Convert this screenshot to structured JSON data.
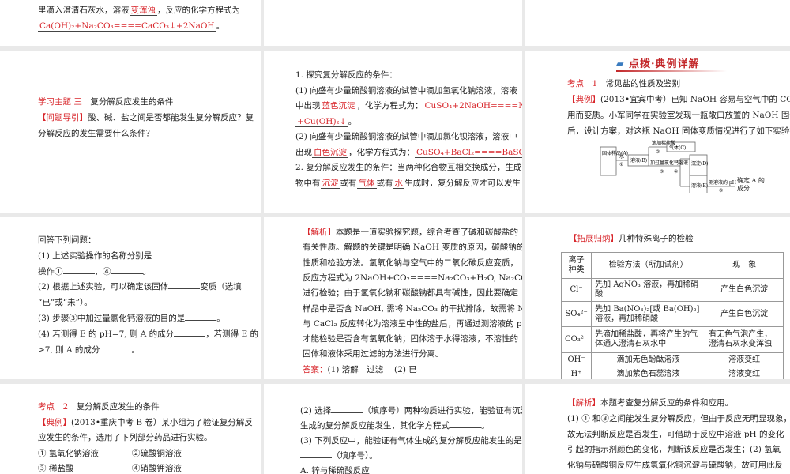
{
  "slides": [
    {
      "id": "s1",
      "lines": [
        [
          {
            "t": "里滴入澄清石灰水，溶液"
          },
          {
            "t": "变浑浊",
            "s": "redblank"
          },
          {
            "t": "，反应的化学方程式为"
          }
        ],
        [
          {
            "t": "Ca(OH)₂+Na₂CO₃====CaCO₃↓+2NaOH",
            "s": "redblank"
          },
          {
            "t": "。"
          }
        ]
      ]
    },
    {
      "id": "s2",
      "lines": [
        [
          {
            "t": "学习主题 三",
            "s": "red"
          },
          {
            "t": "　复分解反应发生的条件"
          }
        ],
        [
          {
            "t": "【问题导引】",
            "s": "red"
          },
          {
            "t": "酸、碱、盐之间是否都能发生复分解反应？复"
          }
        ],
        [
          {
            "t": "分解反应的发生需要什么条件？"
          }
        ]
      ]
    },
    {
      "id": "s3",
      "lines": [
        [
          {
            "t": "1. 探究复分解反应的条件："
          }
        ],
        [
          {
            "t": "(1) 向盛有少量硫酸铜溶液的试管中滴加氢氧化钠溶液，溶液"
          }
        ],
        [
          {
            "t": "中出现"
          },
          {
            "t": "蓝色沉淀",
            "s": "redblank"
          },
          {
            "t": "，化学方程式为："
          },
          {
            "t": "CuSO₄+2NaOH====Na₂SO₄",
            "s": "redblank"
          }
        ],
        [
          {
            "t": "+Cu(OH)₂↓",
            "s": "redblank"
          },
          {
            "t": "。"
          }
        ],
        [
          {
            "t": "(2) 向盛有少量硫酸铜溶液的试管中滴加氯化钡溶液，溶液中"
          }
        ],
        [
          {
            "t": "出现"
          },
          {
            "t": "白色沉淀",
            "s": "redblank"
          },
          {
            "t": "，化学方程式为："
          },
          {
            "t": "CuSO₄+BaCl₂====BaSO₄↓+CuCl₂",
            "s": "redblank"
          },
          {
            "t": "。"
          }
        ],
        [
          {
            "t": "2. 复分解反应发生的条件：当两种化合物互相交换成分，生成"
          }
        ],
        [
          {
            "t": "物中有"
          },
          {
            "t": "沉淀",
            "s": "redblank"
          },
          {
            "t": "或有"
          },
          {
            "t": "气体",
            "s": "redblank"
          },
          {
            "t": "或有"
          },
          {
            "t": "水",
            "s": "redblank"
          },
          {
            "t": "生成时，复分解反应才可以发生"
          }
        ]
      ]
    },
    {
      "id": "s4",
      "lines": [
        [
          {
            "t": "考点　1",
            "s": "red"
          },
          {
            "t": "　常见盐的性质及鉴别"
          }
        ],
        [
          {
            "t": "【典例】",
            "s": "red"
          },
          {
            "t": "(2013•宜宾中考）已知 NaOH 容易与空气中的 CO₂ 作"
          }
        ],
        [
          {
            "t": "用而变质。小军同学在实验室发现一瓶敞口放置的 NaOH 固体"
          }
        ],
        [
          {
            "t": "后，设计方案，对这瓶 NaOH 固体变质情况进行了如下实验探究："
          }
        ]
      ]
    },
    {
      "id": "s5",
      "lines": [
        [
          {
            "t": "回答下列问题："
          }
        ],
        [
          {
            "t": "(1) 上述实验操作的名称分别是"
          }
        ],
        [
          {
            "t": "操作①"
          },
          {
            "t": "",
            "s": "blank"
          },
          {
            "t": "，④"
          },
          {
            "t": "",
            "s": "blank"
          },
          {
            "t": "。"
          }
        ],
        [
          {
            "t": "(2) 根据上述实验，可以确定该固体"
          },
          {
            "t": "",
            "s": "blank"
          },
          {
            "t": "变质（选填"
          }
        ],
        [
          {
            "t": "“已”或“未”）。"
          }
        ],
        [
          {
            "t": "(3) 步骤③中加过量氯化钙溶液的目的是"
          },
          {
            "t": "",
            "s": "blank"
          },
          {
            "t": "。"
          }
        ],
        [
          {
            "t": "(4) 若测得 E 的 pH=7, 则 A 的成分"
          },
          {
            "t": "",
            "s": "blank"
          },
          {
            "t": "，若测得 E 的 pH"
          }
        ],
        [
          {
            "t": ">7, 则 A 的成分"
          },
          {
            "t": "",
            "s": "blank"
          },
          {
            "t": "。"
          }
        ]
      ]
    },
    {
      "id": "s6",
      "lines": [
        [
          {
            "t": "【解析】",
            "s": "red"
          },
          {
            "t": "本题是一道实验探究题，综合考查了碱和碳酸盐的"
          }
        ],
        [
          {
            "t": "有关性质。解题的关键是明确 NaOH 变质的原因，碳酸钠的"
          }
        ],
        [
          {
            "t": "性质和检验方法。氢氧化钠与空气中的二氧化碳反应变质，"
          }
        ],
        [
          {
            "t": "反应方程式为 2NaOH+CO₂====Na₂CO₃+H₂O, Na₂CO₃ 可用稀盐酸"
          }
        ],
        [
          {
            "t": "进行检验；由于氢氧化钠和碳酸钠都具有碱性，因此要确定"
          }
        ],
        [
          {
            "t": "样品中是否含 NaOH, 需将 Na₂CO₃ 的干扰排除，故需将 Na₂CO₃"
          }
        ],
        [
          {
            "t": "与 CaCl₂ 反应转化为溶液呈中性的盐后，再通过测溶液的 pH"
          }
        ],
        [
          {
            "t": "才能检验是否含有氢氧化钠；固体溶于水得溶液，不溶性的"
          }
        ],
        [
          {
            "t": "固体和液体采用过滤的方法进行分离。"
          }
        ],
        [
          {
            "t": "答案：",
            "s": "red"
          },
          {
            "t": "(1) 溶解　过滤　 (2) 已"
          }
        ],
        [
          {
            "t": "(3) 完全除去碳酸钠　(4) 碳酸钠　氢氧化钠和碳酸钠"
          }
        ]
      ]
    },
    {
      "id": "s8",
      "lines": [
        [
          {
            "t": "考点　2",
            "s": "red"
          },
          {
            "t": "　复分解反应发生的条件"
          }
        ],
        [
          {
            "t": "【典例】",
            "s": "red"
          },
          {
            "t": "(2013•重庆中考 B 卷）某小组为了验证复分解反"
          }
        ],
        [
          {
            "t": "应发生的条件，选用了下列部分药品进行实验。"
          }
        ],
        [
          {
            "t": "① 氢氧化钠溶液　　　　②硫酸铜溶液"
          }
        ],
        [
          {
            "t": "③ 稀盐酸　　　　　　　④硝酸钾溶液"
          }
        ]
      ]
    },
    {
      "id": "s9",
      "lines": [
        [
          {
            "t": "(2) 选择"
          },
          {
            "t": "",
            "s": "blank"
          },
          {
            "t": "（填序号）两种物质进行实验，能验证有沉淀"
          }
        ],
        [
          {
            "t": "生成的复分解反应能发生，其化学方程式"
          },
          {
            "t": "",
            "s": "blank"
          },
          {
            "t": "。"
          }
        ],
        [
          {
            "t": "(3) 下列反应中，能验证有气体生成的复分解反应能发生的是"
          }
        ],
        [
          {
            "t": "",
            "s": "blank"
          },
          {
            "t": "（填序号）。"
          }
        ],
        [
          {
            "t": "A. 锌与稀硫酸反应"
          }
        ]
      ]
    },
    {
      "id": "s10",
      "lines": [
        [
          {
            "t": "【解析】",
            "s": "red"
          },
          {
            "t": "本题考查复分解反应的条件和应用。"
          }
        ],
        [
          {
            "t": "(1) ① 和③之间能发生复分解反应，但由于反应无明显现象，"
          }
        ],
        [
          {
            "t": "故无法判断反应是否发生，可借助于反应中溶液 pH 的变化"
          }
        ],
        [
          {
            "t": "引起的指示剂颜色的变化，判断该反应是否发生；(2) 氢氧"
          }
        ],
        [
          {
            "t": "化钠与硫酸铜反应生成氢氧化铜沉淀与硫酸钠，故可用此反"
          }
        ],
        [
          {
            "t": "应验证有沉淀生成的复分解反应能发生；(3) 复分解反应的"
          }
        ]
      ]
    }
  ],
  "header": {
    "title": "点拨·典例详解"
  },
  "diagram": {
    "sample": "固体样品(A)",
    "water": "水",
    "step1": "①",
    "solution": "溶液(B)",
    "acid": "滴加稀盐酸",
    "step2": "②",
    "gas": "气体(C)",
    "cacl2": "加过量氯化钙溶液",
    "step3": "③",
    "step4": "④",
    "precip": "沉淀(D)",
    "filtrate": "溶液(E)",
    "ph": "测溶液的 pH",
    "step5": "⑤",
    "result": "确定 A 的成分"
  },
  "ion_table": {
    "title_tag": "【拓展归纳】",
    "title": "几种特殊离子的检验",
    "headers": [
      "离子种类",
      "检验方法（所加试剂）",
      "现　象"
    ],
    "rows": [
      [
        "Cl⁻",
        "先加 AgNO₃ 溶液，再加稀硝酸",
        "产生白色沉淀"
      ],
      [
        "SO₄²⁻",
        "先加 Ba(NO₃)₂[或 Ba(OH)₂] 溶液，再加稀硝酸",
        "产生白色沉淀"
      ],
      [
        "CO₃²⁻",
        "先滴加稀盐酸，再将产生的气体通入澄清石灰水中",
        "有无色气泡产生，澄清石灰水变浑浊"
      ],
      [
        "OH⁻",
        "滴加无色酚酞溶液",
        "溶液变红"
      ],
      [
        "H⁺",
        "滴加紫色石蕊溶液",
        "溶液变红"
      ]
    ]
  }
}
